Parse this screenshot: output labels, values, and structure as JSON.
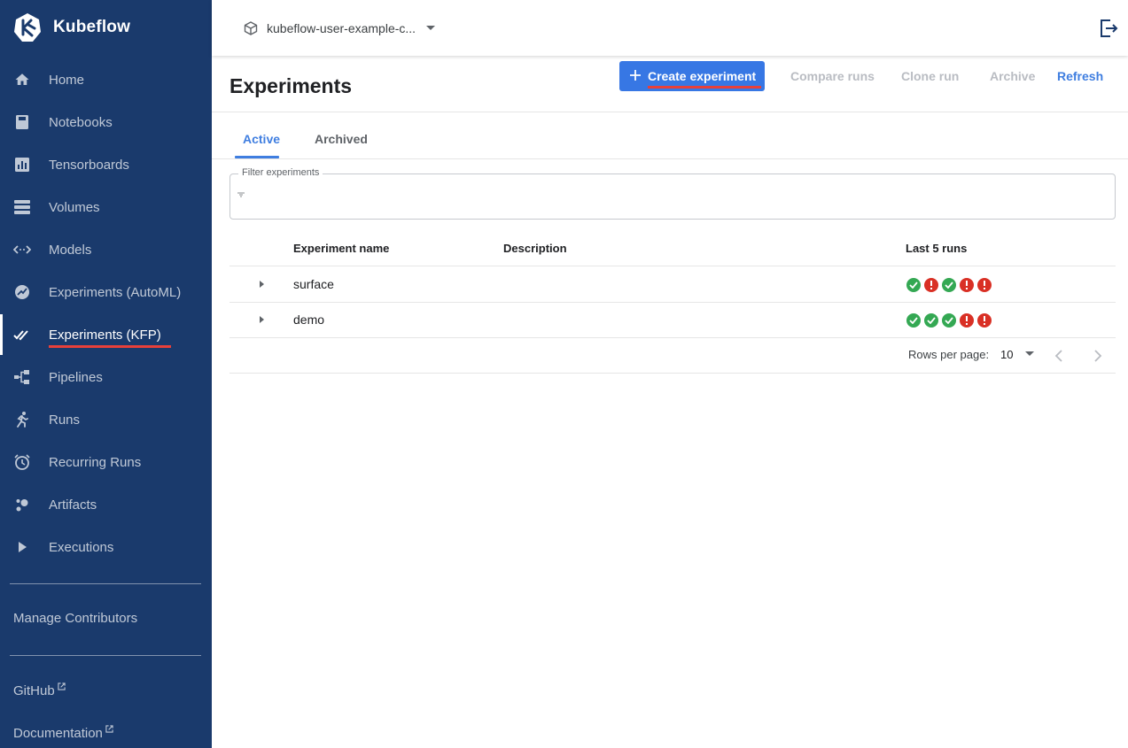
{
  "brand": {
    "name": "Kubeflow"
  },
  "sidebar": {
    "items": [
      {
        "label": "Home",
        "icon": "home-icon"
      },
      {
        "label": "Notebooks",
        "icon": "notebook-icon"
      },
      {
        "label": "Tensorboards",
        "icon": "tensorboard-icon"
      },
      {
        "label": "Volumes",
        "icon": "volumes-icon"
      },
      {
        "label": "Models",
        "icon": "models-icon"
      },
      {
        "label": "Experiments (AutoML)",
        "icon": "automl-icon"
      },
      {
        "label": "Experiments (KFP)",
        "icon": "double-check-icon",
        "active": true
      },
      {
        "label": "Pipelines",
        "icon": "pipelines-icon"
      },
      {
        "label": "Runs",
        "icon": "runner-icon"
      },
      {
        "label": "Recurring Runs",
        "icon": "alarm-clock-icon"
      },
      {
        "label": "Artifacts",
        "icon": "artifacts-icon"
      },
      {
        "label": "Executions",
        "icon": "play-icon"
      }
    ],
    "manage_contributors": "Manage Contributors",
    "github": "GitHub",
    "documentation": "Documentation"
  },
  "topbar": {
    "namespace": "kubeflow-user-example-c..."
  },
  "page": {
    "title": "Experiments"
  },
  "toolbar": {
    "create_label": "Create experiment",
    "compare_label": "Compare runs",
    "clone_label": "Clone run",
    "archive_label": "Archive",
    "refresh_label": "Refresh"
  },
  "tabs": [
    {
      "label": "Active",
      "active": true
    },
    {
      "label": "Archived",
      "active": false
    }
  ],
  "filter": {
    "label": "Filter experiments",
    "value": ""
  },
  "table": {
    "columns": [
      "Experiment name",
      "Description",
      "Last 5 runs"
    ],
    "rows": [
      {
        "name": "surface",
        "description": "",
        "last_runs": [
          "success",
          "failed",
          "success",
          "failed",
          "failed"
        ]
      },
      {
        "name": "demo",
        "description": "",
        "last_runs": [
          "success",
          "success",
          "success",
          "failed",
          "failed"
        ]
      }
    ]
  },
  "pagination": {
    "rows_per_page_label": "Rows per page:",
    "rows_per_page": "10"
  },
  "colors": {
    "sidebar_bg": "#1a3a6c",
    "primary": "#3777e4",
    "accent_underline": "#e8403a",
    "success": "#34a853",
    "failed": "#d93025"
  }
}
